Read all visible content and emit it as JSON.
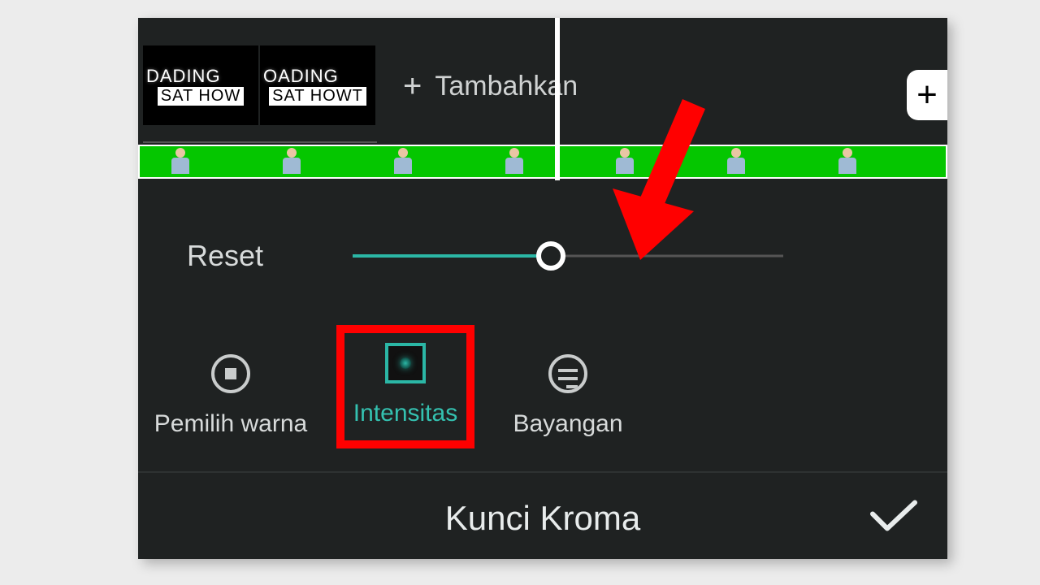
{
  "timeline": {
    "clip1_line1": "DADING",
    "clip1_line2": "SAT HOW",
    "clip2_line1": "OADING",
    "clip2_line2": "SAT HOWT",
    "add_label": "Tambahkan"
  },
  "controls": {
    "reset_label": "Reset",
    "slider_percent": 46
  },
  "options": {
    "color_picker": "Pemilih warna",
    "intensity": "Intensitas",
    "shadow": "Bayangan"
  },
  "footer": {
    "title": "Kunci Kroma"
  }
}
